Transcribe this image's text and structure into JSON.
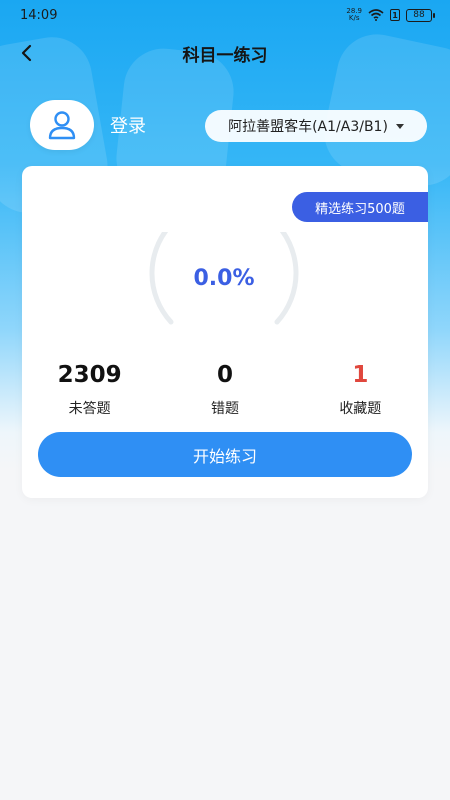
{
  "status_bar": {
    "time": "14:09",
    "net_speed_value": "28.9",
    "net_speed_unit": "K/s",
    "sim_badge": "1",
    "battery": "88"
  },
  "header": {
    "title": "科目一练习"
  },
  "user": {
    "login_label": "登录"
  },
  "vehicle": {
    "selected": "阿拉善盟客车(A1/A3/B1)"
  },
  "card": {
    "featured_badge": "精选练习500题",
    "progress": {
      "label": "0.0%",
      "percent": 0
    },
    "stats": [
      {
        "value": "2309",
        "label": "未答题"
      },
      {
        "value": "0",
        "label": "错题"
      },
      {
        "value": "1",
        "label": "收藏题"
      }
    ],
    "start_button": "开始练习"
  },
  "colors": {
    "accent_blue": "#3b5fe3",
    "button_blue": "#2f8ff4",
    "favorite_red": "#e0473d",
    "header_gradient_top": "#1aa7f2"
  },
  "icons": {
    "back": "chevron-left-icon",
    "avatar": "user-icon",
    "dropdown": "caret-down-icon",
    "wifi": "wifi-icon",
    "battery": "battery-icon"
  }
}
